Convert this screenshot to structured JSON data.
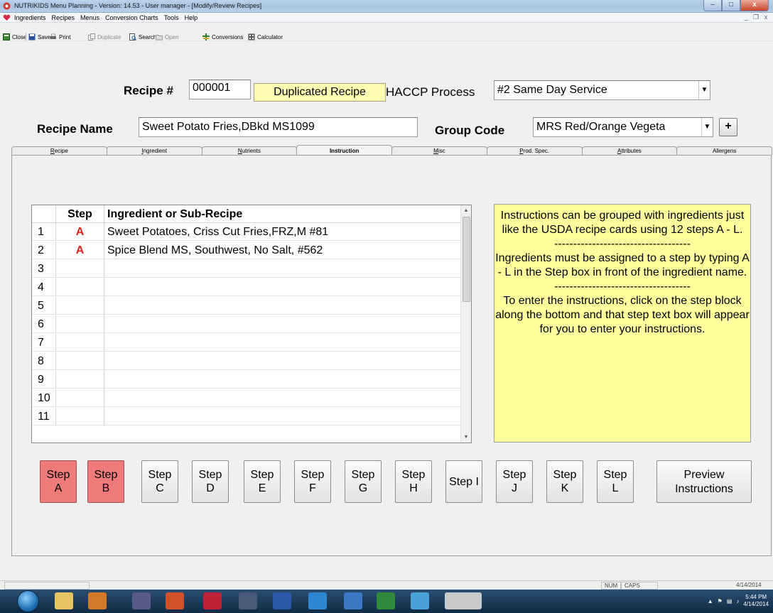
{
  "window": {
    "title": "NUTRIKIDS Menu Planning - Version: 14.53 - User manager - [Modify/Review Recipes]"
  },
  "menubar": [
    "Ingredients",
    "Recipes",
    "Menus",
    "Conversion Charts",
    "Tools",
    "Help"
  ],
  "toolbar": {
    "close": "Close",
    "save": "Save",
    "print": "Print",
    "duplicate": "Duplicate",
    "search": "Search",
    "open": "Open",
    "conversions": "Conversions",
    "calculator": "Calculator"
  },
  "form": {
    "recipe_no_label": "Recipe #",
    "recipe_no": "000001",
    "duplicated_badge": "Duplicated Recipe",
    "haccp_label": "HACCP Process",
    "haccp_value": "#2 Same Day Service",
    "recipe_name_label": "Recipe Name",
    "recipe_name": "Sweet Potato Fries,DBkd MS1099",
    "group_code_label": "Group Code",
    "group_code": "MRS Red/Orange Vegeta",
    "add_button": "+"
  },
  "tabs": [
    "Recipe",
    "Ingredient",
    "Nutrients",
    "Instruction",
    "Misc",
    "Prod. Spec.",
    "Attributes",
    "Allergens"
  ],
  "active_tab": "Instruction",
  "grid": {
    "headers": [
      "Step",
      "Ingredient or Sub-Recipe"
    ],
    "rows": [
      {
        "num": "1",
        "step": "A",
        "ingredient": "Sweet Potatoes, Criss Cut Fries,FRZ,M #81"
      },
      {
        "num": "2",
        "step": "A",
        "ingredient": "Spice Blend MS, Southwest, No Salt, #562"
      },
      {
        "num": "3",
        "step": "",
        "ingredient": ""
      },
      {
        "num": "4",
        "step": "",
        "ingredient": ""
      },
      {
        "num": "5",
        "step": "",
        "ingredient": ""
      },
      {
        "num": "6",
        "step": "",
        "ingredient": ""
      },
      {
        "num": "7",
        "step": "",
        "ingredient": ""
      },
      {
        "num": "8",
        "step": "",
        "ingredient": ""
      },
      {
        "num": "9",
        "step": "",
        "ingredient": ""
      },
      {
        "num": "10",
        "step": "",
        "ingredient": ""
      },
      {
        "num": "11",
        "step": "",
        "ingredient": ""
      }
    ]
  },
  "info": {
    "p1": "Instructions can be grouped with ingredients just like the USDA recipe cards using 12 steps A - L.",
    "sep": "------------------------------------",
    "p2": "Ingredients must be assigned to a step by typing A - L in the Step box in front of the ingredient name.",
    "p3": "To enter the instructions, click on the step block along the bottom and that step text box will appear for you to enter your instructions."
  },
  "steps": [
    {
      "l1": "Step",
      "l2": "A"
    },
    {
      "l1": "Step",
      "l2": "B"
    },
    {
      "l1": "Step",
      "l2": "C"
    },
    {
      "l1": "Step",
      "l2": "D"
    },
    {
      "l1": "Step",
      "l2": "E"
    },
    {
      "l1": "Step",
      "l2": "F"
    },
    {
      "l1": "Step",
      "l2": "G"
    },
    {
      "l1": "Step",
      "l2": "H"
    },
    {
      "l1": "Step I",
      "l2": ""
    },
    {
      "l1": "Step",
      "l2": "J"
    },
    {
      "l1": "Step",
      "l2": "K"
    },
    {
      "l1": "Step",
      "l2": "L"
    }
  ],
  "preview": {
    "l1": "Preview",
    "l2": "Instructions"
  },
  "status": {
    "num": "NUM",
    "caps": "CAPS",
    "date": "4/14/2014"
  },
  "taskbar": {
    "time": "5:44 PM",
    "date": "4/14/2014"
  },
  "colors": {
    "highlight_step": "#f07a7a",
    "info_bg": "#ffff9e",
    "step_letter": "#e0201a",
    "badge_bg": "#fffdb3"
  }
}
